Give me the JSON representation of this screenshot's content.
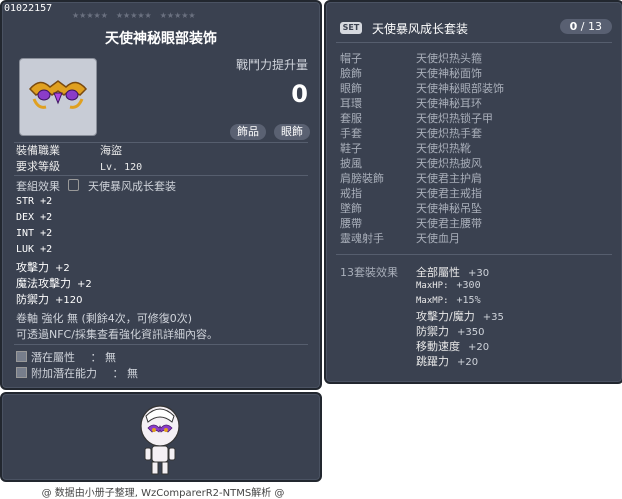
{
  "item": {
    "id": "01022157",
    "star_groups": [
      "★★★★★",
      "★★★★★",
      "★★★★★"
    ],
    "name": "天使神秘眼部装饰",
    "cp_label": "戰鬥力提升量",
    "cp_value": "0",
    "tags": [
      "飾品",
      "眼飾"
    ],
    "job_label": "裝備職業",
    "job_value": "海盜",
    "level_label": "要求等級",
    "level_value": "Lv. 120",
    "set_label": "套組效果",
    "set_value": "天使暴风成长套装",
    "stats": [
      {
        "name": "STR",
        "value": "+2"
      },
      {
        "name": "DEX",
        "value": "+2"
      },
      {
        "name": "INT",
        "value": "+2"
      },
      {
        "name": "LUK",
        "value": "+2"
      },
      {
        "name": "攻擊力",
        "value": "+2"
      },
      {
        "name": "魔法攻擊力",
        "value": "+2"
      },
      {
        "name": "防禦力",
        "value": "+120"
      }
    ],
    "upgrade_text": "卷軸 強化 無 (剩餘4次，可修復0次)",
    "nfc_text": "可透過NFC/採集查看強化資訊詳細內容。",
    "potential_label": "潛在屬性",
    "potential_value": "： 無",
    "bonus_potential_label": "附加潛在能力",
    "bonus_potential_value": "： 無"
  },
  "set": {
    "badge": "SET",
    "name": "天使暴风成长套装",
    "count_current": "0",
    "count_sep": " / ",
    "count_total": "13",
    "items": [
      {
        "slot": "帽子",
        "name": "天使炽热头箍"
      },
      {
        "slot": "臉飾",
        "name": "天使神秘面饰"
      },
      {
        "slot": "眼飾",
        "name": "天使神秘眼部装饰"
      },
      {
        "slot": "耳環",
        "name": "天使神秘耳环"
      },
      {
        "slot": "套服",
        "name": "天使炽热锁子甲"
      },
      {
        "slot": "手套",
        "name": "天使炽热手套"
      },
      {
        "slot": "鞋子",
        "name": "天使炽热靴"
      },
      {
        "slot": "披風",
        "name": "天使炽热披风"
      },
      {
        "slot": "肩膀裝飾",
        "name": "天使君主护肩"
      },
      {
        "slot": "戒指",
        "name": "天使君主戒指"
      },
      {
        "slot": "墜飾",
        "name": "天使神秘吊坠"
      },
      {
        "slot": "腰帶",
        "name": "天使君主腰带"
      },
      {
        "slot": "靈魂射手",
        "name": "天使血月"
      }
    ],
    "bonus_label": "13套裝效果",
    "bonuses": [
      {
        "name": "全部屬性",
        "value": "+30"
      },
      {
        "name": "MaxHP:",
        "value": "+300"
      },
      {
        "name": "MaxMP:",
        "value": "+15%"
      },
      {
        "name": "攻擊力/魔力",
        "value": "+35"
      },
      {
        "name": "防禦力",
        "value": "+350"
      },
      {
        "name": "移動速度",
        "value": "+20"
      },
      {
        "name": "跳躍力",
        "value": "+20"
      }
    ]
  },
  "footer": "@ 数据由小册子整理, WzComparerR2-NTMS解析 @",
  "colors": {
    "panel_bg": "#3a4150",
    "text_dim": "#a9afba",
    "accent_purple": "#8a3cc8"
  }
}
